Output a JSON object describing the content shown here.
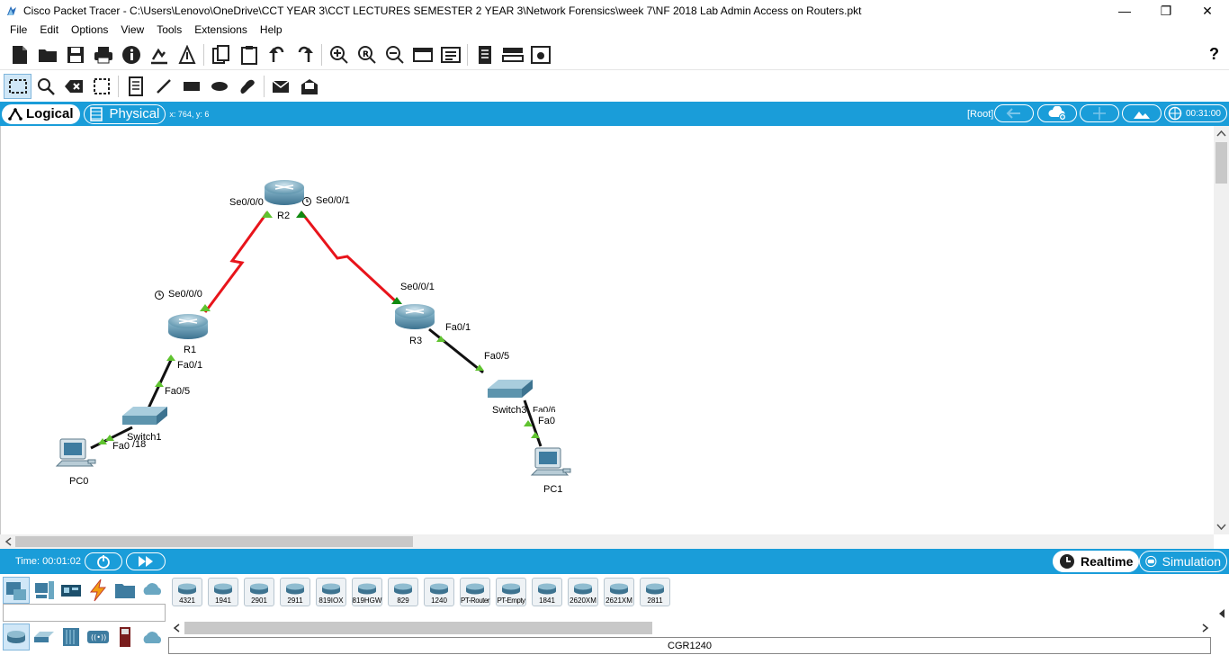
{
  "window": {
    "title": "Cisco Packet Tracer - C:\\Users\\Lenovo\\OneDrive\\CCT YEAR 3\\CCT LECTURES   SEMESTER  2 YEAR 3\\Network Forensics\\week 7\\NF 2018 Lab Admin Access on Routers.pkt",
    "minimize": "—",
    "maximize": "❐",
    "close": "✕"
  },
  "menu": [
    "File",
    "Edit",
    "Options",
    "View",
    "Tools",
    "Extensions",
    "Help"
  ],
  "help_glyph": "?",
  "view_tabs": {
    "logical": "Logical",
    "physical": "Physical",
    "coords": "x: 764, y: 6"
  },
  "topbar_right": {
    "root": "[Root]",
    "clock": "00:31:00"
  },
  "topology": {
    "devices": [
      {
        "id": "R2",
        "label": "R2"
      },
      {
        "id": "R1",
        "label": "R1"
      },
      {
        "id": "R3",
        "label": "R3"
      },
      {
        "id": "Switch1",
        "label": "Switch1"
      },
      {
        "id": "Switch3",
        "label": "Switch3"
      },
      {
        "id": "PC0",
        "label": "PC0"
      },
      {
        "id": "PC1",
        "label": "PC1"
      }
    ],
    "ports": {
      "r2_se000": "Se0/0/0",
      "r2_se001": "Se0/0/1",
      "r1_se000": "Se0/0/0",
      "r3_se001": "Se0/0/1",
      "r1_fa01": "Fa0/1",
      "sw1_fa05": "Fa0/5",
      "r3_fa01": "Fa0/1",
      "sw3_fa05": "Fa0/5",
      "sw1_fa018": "/18",
      "pc0_fa0": "Fa0",
      "sw3_fa06": "Fa0/6",
      "pc1_fa0": "Fa0"
    },
    "link_colors": {
      "serial": "#e8141b",
      "ethernet": "#111111",
      "up": "#5fc32f",
      "down": "#118a11"
    }
  },
  "status": {
    "time": "Time: 00:01:02",
    "realtime": "Realtime",
    "simulation": "Simulation"
  },
  "models": [
    "4321",
    "1941",
    "2901",
    "2911",
    "819IOX",
    "819HGW",
    "829",
    "1240",
    "PT-Router",
    "PT-Empty",
    "1841",
    "2620XM",
    "2621XM",
    "2811"
  ],
  "selected_model": "CGR1240",
  "colors": {
    "accent": "#1a9dd9",
    "router": "#6aa7c2"
  }
}
